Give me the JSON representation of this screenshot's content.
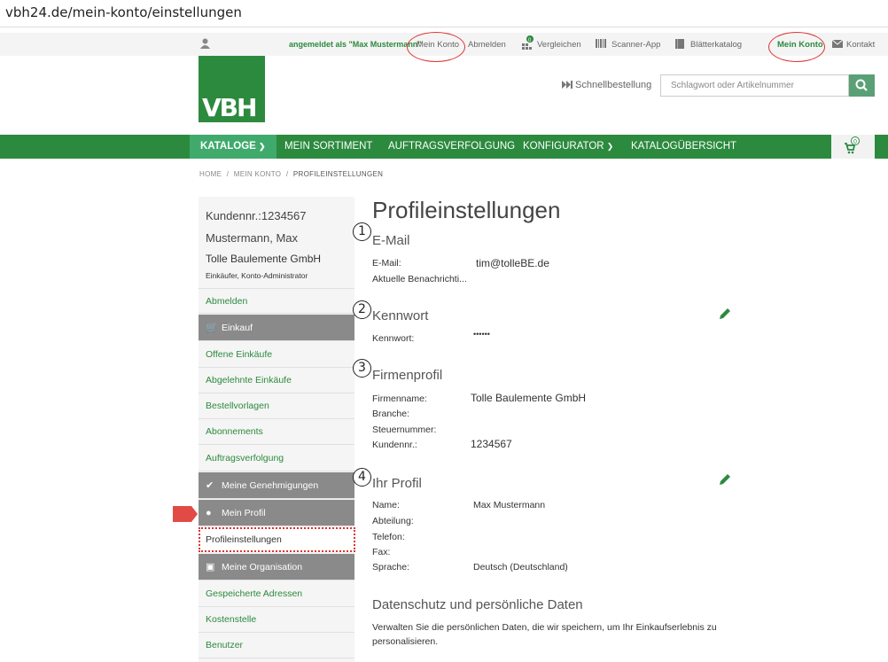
{
  "browser": {
    "url": "vbh24.de/mein-konto/einstellungen"
  },
  "topbar": {
    "logged_in": "angemeldet als \"Max Mustermann\"",
    "mein_konto": "Mein Konto",
    "abmelden": "Abmelden",
    "vergleichen": "Vergleichen",
    "vergleichen_badge": "0",
    "scanner": "Scanner-App",
    "blaetter": "Blätterkatalog",
    "mein_konto_right": "Mein Konto",
    "kontakt": "Kontakt"
  },
  "header": {
    "logo": "VBH",
    "schnellbestellung": "Schnellbestellung",
    "search_placeholder": "Schlagwort oder Artikelnummer"
  },
  "nav": {
    "items": [
      "KATALOGE",
      "MEIN SORTIMENT",
      "AUFTRAGSVERFOLGUNG",
      "KONFIGURATOR",
      "KATALOGÜBERSICHT"
    ],
    "cart_count": "0"
  },
  "breadcrumb": {
    "home": "HOME",
    "sep": "/",
    "konto": "MEIN KONTO",
    "current": "PROFILEINSTELLUNGEN"
  },
  "sidebar": {
    "kundennr": "Kundennr.:1234567",
    "name": "Mustermann, Max",
    "company": "Tolle Baulemente GmbH",
    "role": "Einkäufer, Konto-Administrator",
    "abmelden": "Abmelden",
    "einkauf": "Einkauf",
    "offene": "Offene Einkäufe",
    "abgelehnte": "Abgelehnte Einkäufe",
    "bestellvorlagen": "Bestellvorlagen",
    "abonnements": "Abonnements",
    "auftragsverfolgung": "Auftragsverfolgung",
    "genehmigungen": "Meine Genehmigungen",
    "profil": "Mein Profil",
    "profileinstellungen": "Profileinstellungen",
    "organisation": "Meine Organisation",
    "adressen": "Gespeicherte Adressen",
    "kostenstelle": "Kostenstelle",
    "benutzer": "Benutzer"
  },
  "main": {
    "title": "Profileinstellungen",
    "email": {
      "heading": "E-Mail",
      "label": "E-Mail:",
      "value": "tim@tolleBE.de",
      "notif_label": "Aktuelle Benachrichti..."
    },
    "kennwort": {
      "heading": "Kennwort",
      "label": "Kennwort:",
      "value": "••••••"
    },
    "firmenprofil": {
      "heading": "Firmenprofil",
      "firmenname_label": "Firmenname:",
      "firmenname": "Tolle Baulemente GmbH",
      "branche_label": "Branche:",
      "steuer_label": "Steuernummer:",
      "kunden_label": "Kundennr.:",
      "kundennr": "1234567"
    },
    "profil": {
      "heading": "Ihr Profil",
      "name_label": "Name:",
      "name": "Max Mustermann",
      "abteilung_label": "Abteilung:",
      "telefon_label": "Telefon:",
      "fax_label": "Fax:",
      "sprache_label": "Sprache:",
      "sprache": "Deutsch (Deutschland)"
    },
    "datenschutz": {
      "heading": "Datenschutz und persönliche Daten",
      "text1": "Verwalten Sie die persönlichen Daten, die wir speichern, um Ihr Einkaufserlebnis zu",
      "text2": "personalisieren."
    },
    "annotations": [
      "1",
      "2",
      "3",
      "4"
    ]
  },
  "colors": {
    "brand_green": "#2c8a3e",
    "accent_green": "#40aa6c",
    "sidebar_gray": "#8a8a8a",
    "annotation_red": "#d33333"
  }
}
